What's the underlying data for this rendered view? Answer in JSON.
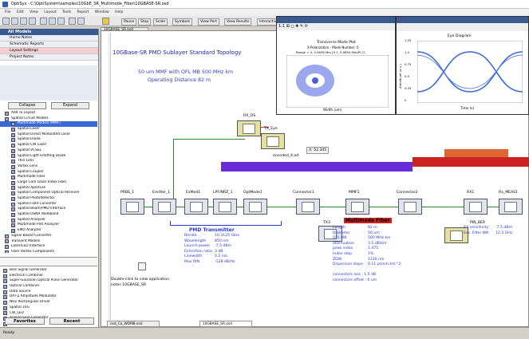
{
  "window": {
    "title": "OptiSys - C:\\OptiSystem\\samples\\10GbE_SR_Multimode_Fiber\\10GBASE-SR.osd"
  },
  "menu": [
    "File",
    "Edit",
    "View",
    "Layout",
    "Tools",
    "Report",
    "Window",
    "Help"
  ],
  "sidebar": {
    "header": "All Models",
    "rows": [
      "Home Notes",
      "Schematic Reports",
      "Layout Settings",
      "Project Notes"
    ],
    "collapse_label": "Collapse",
    "expand_label": "Expand",
    "tree": [
      "Add To Layout",
      "Spatial Circuit Models",
      "Multimode Models (MMF)",
      "Spatial Laser",
      "Spatial Direct Modulated Laser",
      "Spatial Diode",
      "Spatial CW Laser",
      "Spatial VCSEL",
      "Spatial Light Emitting Diode",
      "Thin Lens",
      "Vortex Lens",
      "Spatial Coupler",
      "Multimode Fiber",
      "Large Core Glass Index Fiber",
      "Spatial Aperture",
      "Spatial Component Optical Receiver",
      "Spatial Photodetector",
      "Spatial Field Converter",
      "Spatial Beam/PMD Interface",
      "Spatial OSNR Wideband",
      "Spatial Analyzer",
      "Multimode Plot Analyzer",
      "EMD Analyzer",
      "Signal Based Converter",
      "Transient Models",
      "Laser/LED Interface",
      "Fiber Vortex Components",
      "General Purpose Models",
      "Custom Models",
      "Compound Components",
      "Generators Elements",
      "User Libraries"
    ],
    "list2": [
      "Bias Signal Generator",
      "Electrical Combiner",
      "Super-Gaussian Optical Pulse Generator",
      "Optical Combiner",
      "Data Source",
      "DAT-2 Amplitude Modulator",
      "NRZ Rectangular Driver",
      "Spatial 10G",
      "CW_LED",
      "Analog Sine Generator",
      "Modulator",
      "Multiplier",
      "Nonlinear Filter",
      "Time Dependent Optical Filter"
    ],
    "tabs": [
      "Favorites",
      "Recent"
    ]
  },
  "toolbar": {
    "labels": [
      "Pause",
      "Stop",
      "Scale",
      "Symbols",
      "View Port",
      "View Results",
      "Interactive"
    ]
  },
  "doc_tab": "10GBASE_SR.osd",
  "layout": {
    "title": "10GBase-SR  PMD Sublayer Standard Topology",
    "subtitle1": "50 um MMF with OFL MB 500 MHz km",
    "subtitle2": "Operating Distance 82 m",
    "pmd_label": "PMD Transmitter",
    "mmf_label": "Multimode Fiber",
    "pmd_specs": [
      [
        "Bitrate",
        "10.3125 Gb/s"
      ],
      [
        "Wavelength",
        "850 nm"
      ],
      [
        "Launch power",
        "-7.5 dBm"
      ],
      [
        "Extinction ratio",
        "3 dB"
      ],
      [
        "Linewidth",
        "0.2 nm"
      ],
      [
        "Max RIN",
        "-128 dB/Hz"
      ]
    ],
    "mmf_specs": [
      [
        "Length",
        "82 m"
      ],
      [
        "Diameter",
        "50 um"
      ],
      [
        "OFL MB",
        "500 MHz km"
      ],
      [
        "Attenuation",
        "3.5 dB/km"
      ],
      [
        "peak index",
        "1.475"
      ],
      [
        "Index step",
        "1%"
      ],
      [
        "ZDW",
        "1316 nm"
      ],
      [
        "Dispersion slope",
        "0.11 ps/nm.km^2"
      ]
    ],
    "loss_lines": [
      "connectors loss : 1.5 dB",
      "connectors offset : 6 um"
    ],
    "rx_specs": [
      [
        "RX sensitivity",
        "-7.5 dBm"
      ],
      [
        "Exc. Filter BW",
        "12.3 GHz"
      ]
    ],
    "blocks": [
      "PRBS_1",
      "Emitter_1",
      "ExMod1",
      "LPF/NRZ_1",
      "OptMode1",
      "Connector1",
      "MMF1",
      "Connector2",
      "RX1",
      "Rx_MEAS1",
      "RX_OS",
      "TX_Eye",
      "TX3",
      "PIN_BER"
    ],
    "note1": "Double-click to view application",
    "note2": "notes 10GBASE_SR",
    "encoded_label": "encoded_4.ad",
    "coord_label": "X: 52.345"
  },
  "plot_window": {
    "title": "Transverse Mode Plot",
    "line2": "X-Polarization - Mode Number: 0",
    "line3": "Range = 0, 0.5638 Mm [0 1, 0.5854 Mm/Pl-7]",
    "xlabel": "Width (um)",
    "toolbar_hint": "1:1 ⊞ ◻ ✚ ✎ ⟳"
  },
  "eye_window": {
    "title": "Eye Diagram",
    "xlabel": "Time (s)",
    "ylabel": "Amplitude (a.u.)",
    "yticks": [
      "1.25",
      "1.0",
      "0.75",
      "0.5",
      "0.25",
      "0"
    ]
  },
  "status": {
    "text": "Ready",
    "tab": "osd_Ca_WDM8.osd",
    "tab2": "10GBASE_SR.osd"
  }
}
